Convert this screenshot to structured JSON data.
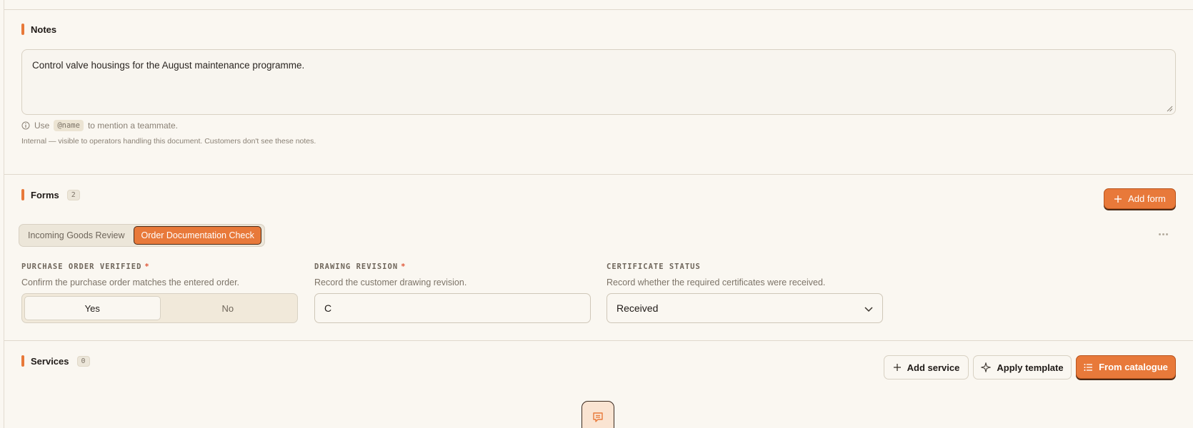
{
  "notes": {
    "title": "Notes",
    "value": "Control valve housings for the August maintenance programme.",
    "hint_prefix": "Use",
    "hint_code": "@name",
    "hint_suffix": "to mention a teammate.",
    "internal_note": "Internal — visible to operators handling this document. Customers don't see these notes."
  },
  "forms": {
    "title": "Forms",
    "count": "2",
    "add_label": "Add form",
    "tabs": [
      {
        "label": "Incoming Goods Review",
        "active": false
      },
      {
        "label": "Order Documentation Check",
        "active": true
      }
    ],
    "fields": {
      "po_verified": {
        "label": "PURCHASE ORDER VERIFIED",
        "required": "*",
        "help": "Confirm the purchase order matches the entered order.",
        "yes": "Yes",
        "no": "No",
        "selected": "Yes"
      },
      "drawing_revision": {
        "label": "DRAWING REVISION",
        "required": "*",
        "help": "Record the customer drawing revision.",
        "value": "C"
      },
      "certificate_status": {
        "label": "CERTIFICATE STATUS",
        "help": "Record whether the required certificates were received.",
        "value": "Received"
      }
    }
  },
  "services": {
    "title": "Services",
    "count": "0",
    "add_label": "Add service",
    "template_label": "Apply template",
    "catalogue_label": "From catalogue"
  },
  "colors": {
    "accent": "#e8793a",
    "background": "#faf7f1",
    "required": "#e0583a"
  },
  "icons": [
    "info-icon",
    "plus-icon",
    "sparkle-icon",
    "list-icon",
    "chevron-down-icon",
    "more-icon",
    "receipt-icon"
  ]
}
